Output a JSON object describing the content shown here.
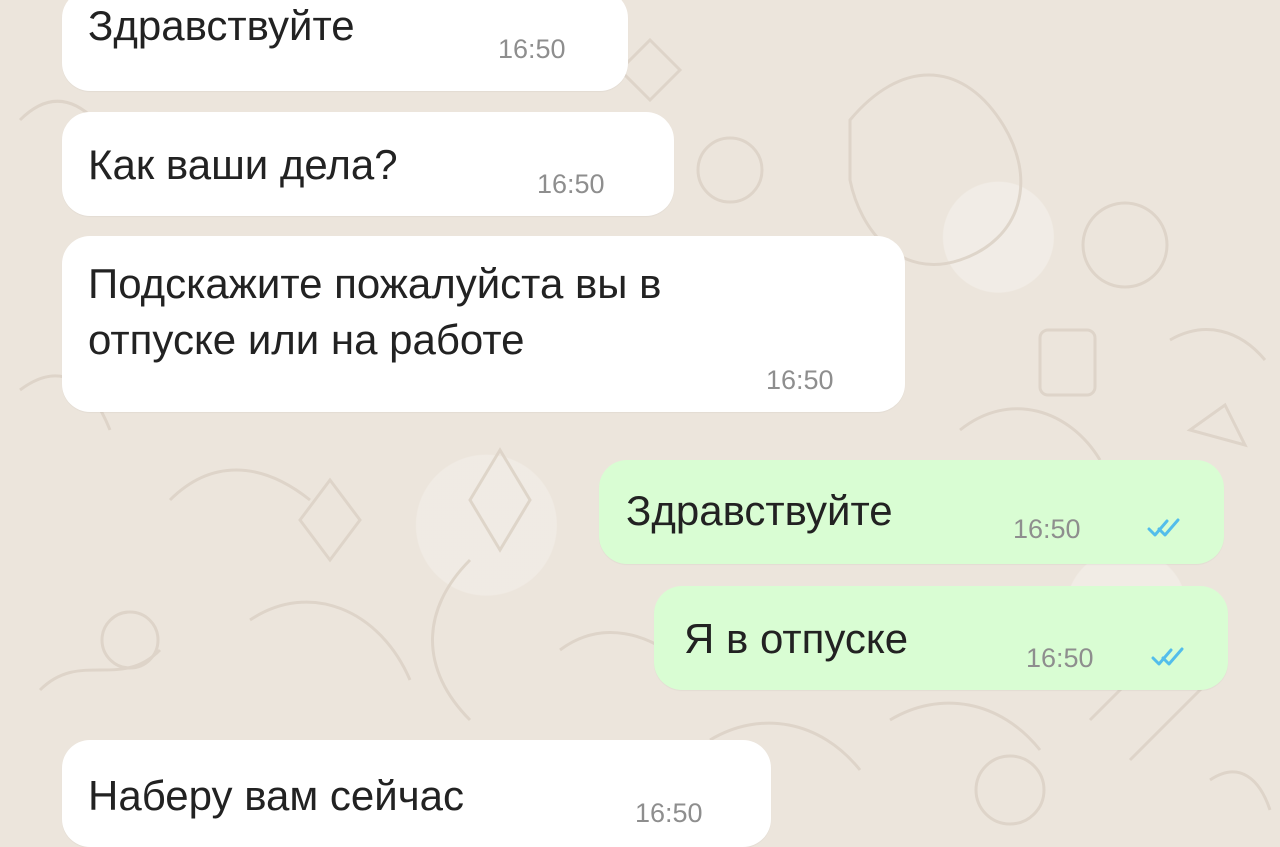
{
  "colors": {
    "incoming_bubble": "#ffffff",
    "outgoing_bubble": "#d9fdd3",
    "message_text": "#222222",
    "timestamp": "#8e8e8e",
    "read_receipt": "#53bdeb",
    "background": "#ece5dc"
  },
  "messages": [
    {
      "direction": "incoming",
      "text": "Здравствуйте",
      "time": "16:50"
    },
    {
      "direction": "incoming",
      "text": "Как ваши дела?",
      "time": "16:50"
    },
    {
      "direction": "incoming",
      "text": "Подскажите пожалуйста вы в\nотпуске или на работе",
      "time": "16:50"
    },
    {
      "direction": "outgoing",
      "text": "Здравствуйте",
      "time": "16:50",
      "status_icon": "double-check-icon"
    },
    {
      "direction": "outgoing",
      "text": "Я в отпуске",
      "time": "16:50",
      "status_icon": "double-check-icon"
    },
    {
      "direction": "incoming",
      "text": "Наберу вам сейчас",
      "time": "16:50"
    }
  ]
}
